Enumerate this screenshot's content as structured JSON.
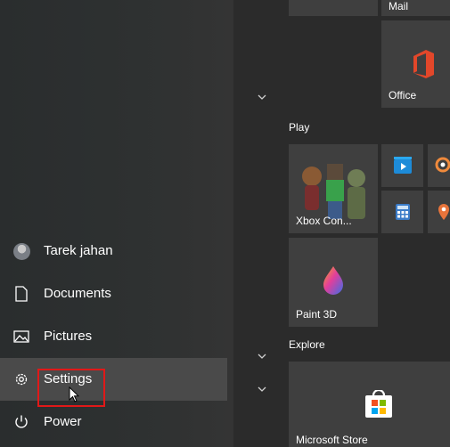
{
  "user": {
    "name": "Tarek jahan"
  },
  "rail": {
    "documents": "Documents",
    "pictures": "Pictures",
    "settings": "Settings",
    "power": "Power"
  },
  "tiles": {
    "mail": "Mail",
    "office": "Office",
    "xbox": "Xbox Con...",
    "paint3d": "Paint 3D",
    "store": "Microsoft Store"
  },
  "groups": {
    "play": "Play",
    "explore": "Explore"
  },
  "colors": {
    "highlight_box": "#e11818",
    "tile_bg": "#3f3f3f",
    "rail_hover": "#4a4a4a"
  }
}
